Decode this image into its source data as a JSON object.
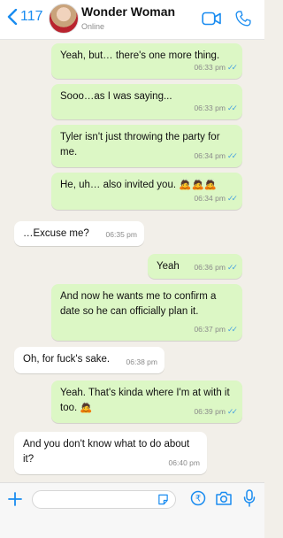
{
  "header": {
    "back_count": "117",
    "contact_name": "Wonder Woman",
    "status": "Online",
    "icons": [
      "chevron-left-icon",
      "video-call-icon",
      "phone-call-icon"
    ]
  },
  "messages": [
    {
      "dir": "out",
      "text": "Yeah, but… there's one more thing.",
      "time": "06:33 pm",
      "read": true
    },
    {
      "dir": "out",
      "text": "Sooo…as I was saying...",
      "time": "06:33 pm",
      "read": true
    },
    {
      "dir": "out",
      "text": "Tyler isn't just throwing the party for me.",
      "time": "06:34 pm",
      "read": true
    },
    {
      "dir": "out",
      "text": "He, uh… also invited you. 🙇🙇🙇",
      "time": "06:34 pm",
      "read": true
    },
    {
      "dir": "in",
      "text": "…Excuse me?",
      "time": "06:35 pm"
    },
    {
      "dir": "out",
      "text": "Yeah",
      "time": "06:36 pm",
      "read": true
    },
    {
      "dir": "out",
      "text": "And now he wants me to confirm a date so he can officially plan it.",
      "time": "06:37 pm",
      "read": true
    },
    {
      "dir": "in",
      "text": "Oh, for fuck's sake.",
      "time": "06:38 pm"
    },
    {
      "dir": "out",
      "text": "Yeah. That's kinda where I'm at with it too. 🙇",
      "time": "06:39 pm",
      "read": true
    },
    {
      "dir": "in",
      "text": "And you don't know what to do about it?",
      "time": "06:40 pm"
    }
  ],
  "colors": {
    "accent": "#1a8cf0",
    "outgoing_bubble": "#dcf7c5",
    "incoming_bubble": "#ffffff",
    "read_ticks": "#4aa3e0",
    "background": "#f2efe9"
  },
  "inputbar": {
    "icons": [
      "plus-icon",
      "sticker-icon",
      "rupee-payment-icon",
      "camera-icon",
      "microphone-icon"
    ]
  }
}
